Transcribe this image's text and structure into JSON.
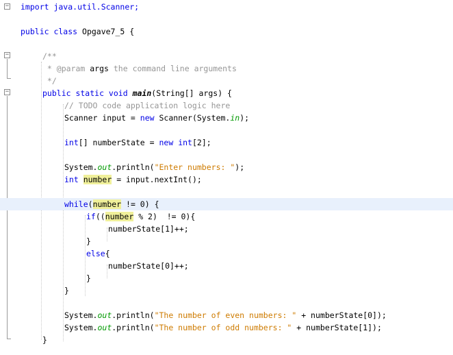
{
  "editor": {
    "lines": {
      "import": "import java.util.Scanner;",
      "class_kw": "public class",
      "class_name": " Opgave7_5 {",
      "doc_open": "/**",
      "doc_param_a": " * @param ",
      "doc_param_b": "args",
      "doc_param_c": " the command line arguments",
      "doc_close": " */",
      "main_kw": "public static void ",
      "main_name": "main",
      "main_rest": "(String[] args) {",
      "todo": "// TODO code application logic here",
      "scanner_a": "Scanner input = ",
      "scanner_new": "new",
      "scanner_b": " Scanner(System.",
      "scanner_in": "in",
      "scanner_c": ");",
      "arr_int": "int",
      "arr_a": "[] numberState = ",
      "arr_new": "new",
      "arr_int2": " int",
      "arr_b": "[2];",
      "print1_a": "System.",
      "print1_out": "out",
      "print1_b": ".println(",
      "print1_str": "\"Enter numbers: \"",
      "print1_c": ");",
      "num_int": "int",
      "num_var": "number",
      "num_rest": " = input.nextInt();",
      "while_kw": "while",
      "while_a": "(",
      "while_var": "number",
      "while_b": " != 0) {",
      "if_kw": "if",
      "if_a": "((",
      "if_var": "number",
      "if_b": " % 2)  != 0){",
      "inc1": "numberState[1]++;",
      "brace1": "}",
      "else_kw": "else",
      "else_b": "{",
      "inc0": "numberState[0]++;",
      "brace2": "}",
      "brace3": "}",
      "print2_a": "System.",
      "print2_out": "out",
      "print2_b": ".println(",
      "print2_str": "\"The number of even numbers: \"",
      "print2_c": " + numberState[0]);",
      "print3_a": "System.",
      "print3_out": "out",
      "print3_b": ".println(",
      "print3_str": "\"The number of odd numbers: \"",
      "print3_c": " + numberState[1]);",
      "brace_main": "}"
    },
    "fold_glyph": "−",
    "colors": {
      "keyword": "#0000e6",
      "comment": "#969696",
      "string": "#ce7b00",
      "field": "#009900",
      "highlight": "#f0f09a",
      "current_line": "#e8f0fc"
    }
  }
}
